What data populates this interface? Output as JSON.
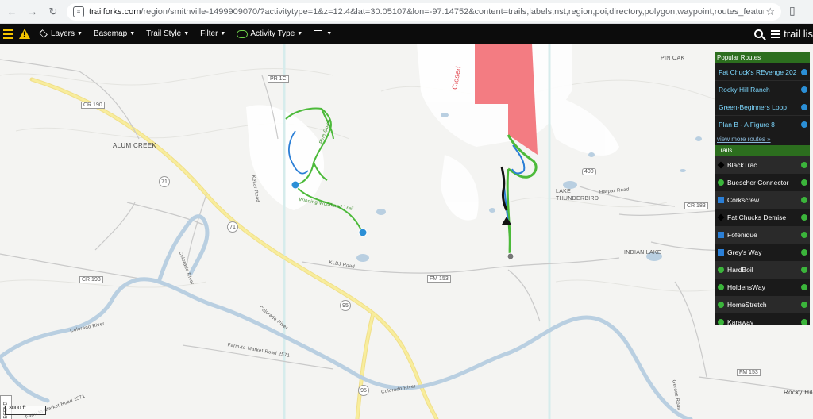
{
  "browser": {
    "url_host": "trailforks.com",
    "url_path": "/region/smithville-1499909070/?activitytype=1&z=12.4&lat=30.05107&lon=-97.14752&content=trails,labels,nst,region,poi,directory,polygon,waypoint,routes_featured"
  },
  "toolbar": {
    "layers": "Layers",
    "basemap": "Basemap",
    "trail_style": "Trail Style",
    "filter": "Filter",
    "activity_type": "Activity Type",
    "trail_list": "trail lis"
  },
  "map": {
    "labels": {
      "alum_creek": "ALUM CREEK",
      "pin_oak": "PIN OAK",
      "lake_thunderbird": "LAKE THUNDERBIRD",
      "indian_lake": "INDIAN LAKE",
      "rocky_hill": "Rocky Hill",
      "closed": "Closed",
      "kellar_road": "Kellar Road",
      "klbj_road": "KLBJ Road",
      "colorado_river_1": "Colorado River",
      "colorado_river_2": "Colorado River",
      "colorado_river_3": "Colorado River",
      "colorado_river_4": "Colorado River",
      "farm_market_road": "Farm-to-Market Road 2571",
      "pine_gulch": "Pine Gulch",
      "winding_woodland": "Winding Woodland Trail",
      "harpar_road": "Harpar Road",
      "gerdes_road": "Gerdes Road",
      "fm_2571": "Farm-to-Market Road 2571"
    },
    "shields": {
      "cr190": "CR 190",
      "pr1c": "PR 1C",
      "r71a": "71",
      "r71b": "71",
      "cr193": "CR 193",
      "fm153a": "FM 153",
      "fm153b": "FM 153",
      "r95a": "95",
      "r95b": "95",
      "cr183": "CR 183",
      "r400": "400"
    },
    "scale": "3000 ft",
    "legend": "LEGEND"
  },
  "panel": {
    "popular_routes_title": "Popular Routes",
    "routes": [
      {
        "label": "Fat Chuck's REvenge 202"
      },
      {
        "label": "Rocky Hill Ranch"
      },
      {
        "label": "Green-Beginners Loop"
      },
      {
        "label": "Plan B - A Figure 8"
      }
    ],
    "view_more": "view more routes »",
    "trails_title": "Trails",
    "trails": [
      {
        "label": "BlackTrac",
        "difficulty": "black"
      },
      {
        "label": "Buescher Connector",
        "difficulty": "green"
      },
      {
        "label": "Corkscrew",
        "difficulty": "blue"
      },
      {
        "label": "Fat Chucks Demise",
        "difficulty": "black"
      },
      {
        "label": "Fofenique",
        "difficulty": "blue"
      },
      {
        "label": "Grey's Way",
        "difficulty": "blue"
      },
      {
        "label": "HardBoil",
        "difficulty": "green"
      },
      {
        "label": "HoldensWay",
        "difficulty": "green"
      },
      {
        "label": "HomeStretch",
        "difficulty": "green"
      },
      {
        "label": "Karaway",
        "difficulty": "green"
      }
    ]
  }
}
